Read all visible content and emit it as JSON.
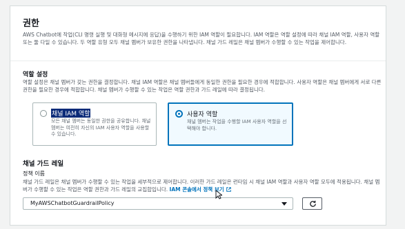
{
  "permissions": {
    "title": "권한",
    "description": "AWS Chatbot에 작업(CLI 명령 실행 및 대화형 메시지에 응답)을 수행하기 위한 IAM 역할이 필요합니다. IAM 역할은 역할 설정에 따라 채널 IAM 역할, 사용자 역할 또는 둘 다일 수 있습니다. 두 역할 유형 모두 채널 멤버가 보유한 권한을 나타냅니다. 채널 가드 레일은 채널 멤버가 수행할 수 있는 작업을 제어합니다."
  },
  "role_settings": {
    "title": "역할 설정",
    "description": "역할 설정은 채널 멤버가 갖는 권한을 결정합니다. 채널 IAM 역할은 채널 멤버들에게 동일한 권한을 필요한 경우에 적합합니다. 사용자 역할은 채널 멤버에게 서로 다른 권한을 필요한 경우에 적합합니다. 채널 멤버가 수행할 수 있는 작업은 역할 권한과 가드 레일에 따라 결정됩니다.",
    "options": [
      {
        "label": "채널 IAM 역할",
        "description": "모든 채널 멤버는 동일한 권한을 공유합니다. 채널 멤버는 여전히 자신의 IAM 사용자 역할을 사용할 수 있습니다.",
        "selected": false
      },
      {
        "label": "사용자 역할",
        "description": "채널 멤버는 작업을 수행할 IAM 사용자 역할을 선택해야 합니다.",
        "selected": true
      }
    ]
  },
  "guardrails": {
    "title": "채널 가드 레일",
    "policy_label": "정책 이름",
    "policy_description": "채널 가드 레일은 채널 멤버가 수행할 수 있는 작업을 세부적으로 제어합니다. 이러한 가드 레일은 런타임 시 채널 IAM 역할과 사용자 역할 모두에 적용됩니다. 채널 멤버가 수행할 수 있는 작업은 역할 권한과 가드 레일의 교집합입니다.",
    "policy_link": "IAM 콘솔에서 정책 보기",
    "selected_policy": "MyAWSChatbotGuardrailPolicy"
  },
  "icons": {
    "external_link": "external-link-icon",
    "refresh": "refresh-icon",
    "dropdown": "caret-down-icon"
  },
  "colors": {
    "accent": "#0073bb",
    "selected_bg": "#f1faff",
    "text_highlight": "#0a2a78"
  }
}
